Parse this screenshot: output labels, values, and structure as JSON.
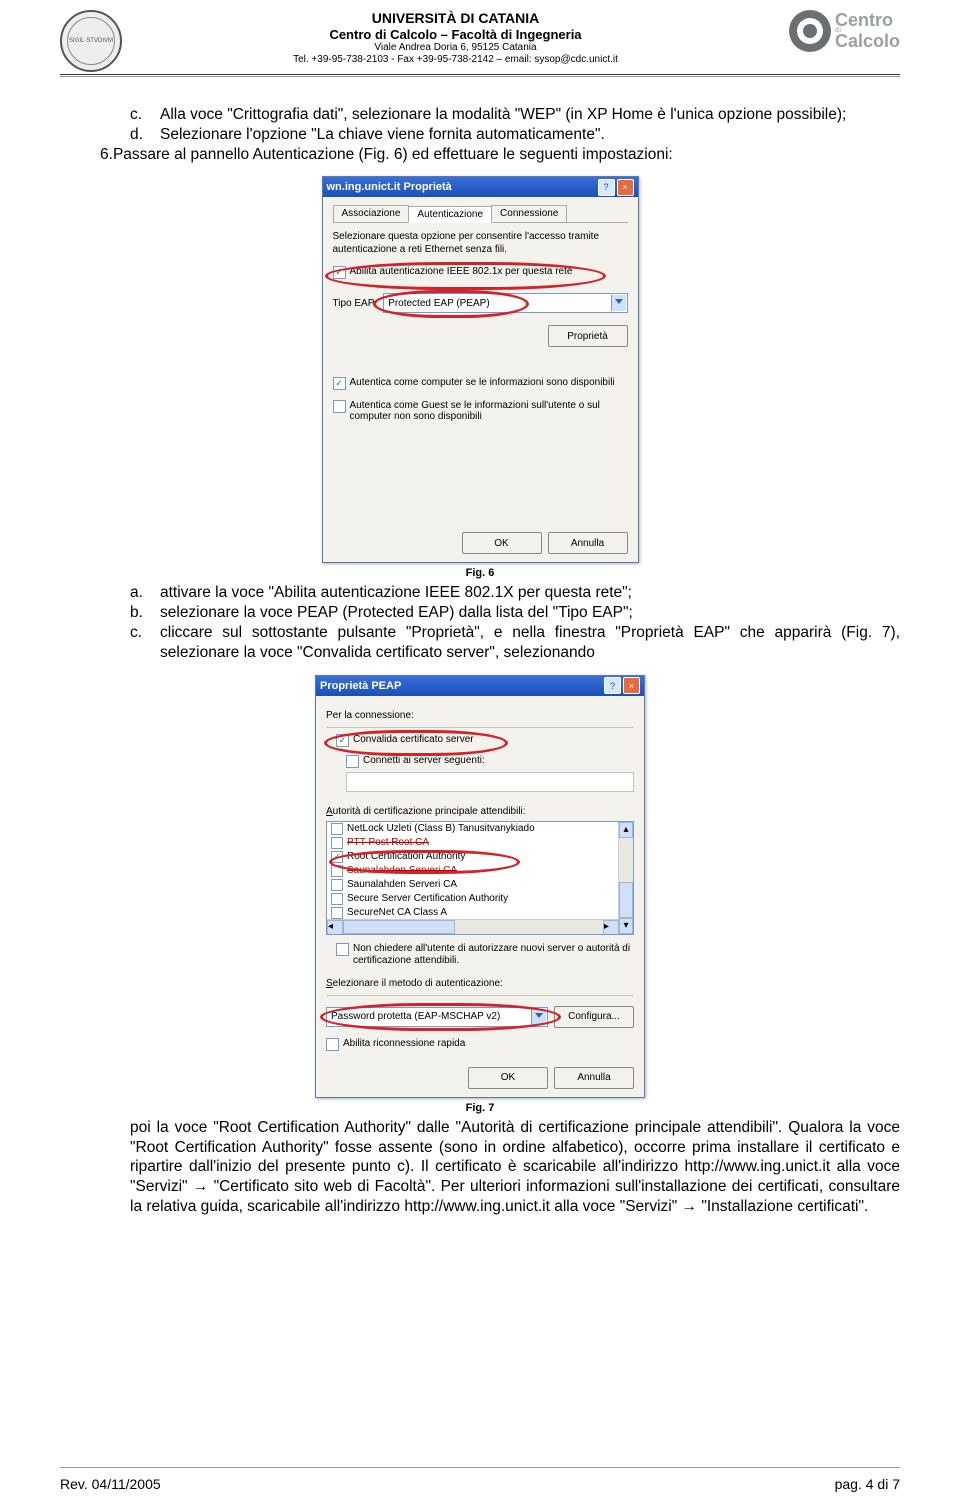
{
  "header": {
    "uni": "UNIVERSITÀ DI CATANIA",
    "centro": "Centro di Calcolo – Facoltà di Ingegneria",
    "addr": "Viale Andrea Doria 6, 95125 Catania",
    "contact": "Tel. +39-95-738-2103  -  Fax +39-95-738-2142 – email: sysop@cdc.unict.it",
    "logo_big": "Centro",
    "logo_sm1": "di",
    "logo_sm2": "Calcolo"
  },
  "body": {
    "c_label": "c.",
    "c_text": "Alla voce \"Crittografia dati\", selezionare la modalità \"WEP\" (in XP Home è l'unica opzione possibile);",
    "d_label": "d.",
    "d_text": "Selezionare l'opzione \"La chiave viene fornita automaticamente\".",
    "p6_label": "6.",
    "p6_text": "Passare al pannello Autenticazione (Fig. 6) ed effettuare le seguenti impostazioni:",
    "fig6_cap": "Fig. 6",
    "a_label": "a.",
    "a_text": "attivare la voce \"Abilita autenticazione IEEE 802.1X per questa rete\";",
    "b_label": "b.",
    "b_text": "selezionare la voce PEAP (Protected EAP) dalla lista del \"Tipo EAP\";",
    "c2_label": "c.",
    "c2_text": "cliccare sul sottostante pulsante \"Proprietà\", e nella finestra \"Proprietà EAP\" che apparirà (Fig. 7), selezionare la voce \"Convalida certificato server\", selezionando",
    "fig7_cap": "Fig. 7",
    "tail": "poi la voce \"Root Certification Authority\" dalle \"Autorità di certificazione principale attendibili\". Qualora la voce \"Root Certification Authority\" fosse assente (sono in ordine alfabetico), occorre prima installare il certificato e ripartire dall'inizio del presente punto c). Il certificato è scaricabile all'indirizzo http://www.ing.unict.it alla voce \"Servizi\" → \"Certificato sito web di Facoltà\". Per ulteriori informazioni sull'installazione dei certificati, consultare la relativa guida, scaricabile all'indirizzo http://www.ing.unict.it alla voce \"Servizi\" → \"Installazione certificati\"."
  },
  "fig6": {
    "title": "wn.ing.unict.it Proprietà",
    "tab1": "Associazione",
    "tab2": "Autenticazione",
    "tab3": "Connessione",
    "lead": "Selezionare questa opzione per consentire l'accesso tramite autenticazione a reti Ethernet senza fili.",
    "chk1": "Abilita autenticazione IEEE 802.1x per questa rete",
    "tipo_lbl": "Tipo EAP:",
    "tipo_val": "Protected EAP (PEAP)",
    "btn_prop": "Proprietà",
    "chk2": "Autentica come computer se le informazioni sono disponibili",
    "chk3": "Autentica come Guest se le informazioni sull'utente o sul computer non sono disponibili",
    "ok": "OK",
    "cancel": "Annulla"
  },
  "fig7": {
    "title": "Proprietà PEAP",
    "group1": "Per la connessione:",
    "chk_conv": "Convalida certificato server",
    "chk_conn": "Connetti ai server seguenti:",
    "auth_lbl": "Autorità di certificazione principale attendibili:",
    "rows": [
      {
        "c": false,
        "t": "NetLock Uzleti (Class B) Tanusitvanykiado"
      },
      {
        "c": false,
        "t": "PTT Post Root CA",
        "strike": true
      },
      {
        "c": true,
        "t": "Root Certification Authority"
      },
      {
        "c": false,
        "t": "Saunalahden Serveri CA",
        "strike": true,
        "partial": true
      },
      {
        "c": false,
        "t": "Saunalahden Serveri CA"
      },
      {
        "c": false,
        "t": "Secure Server Certification Authority"
      },
      {
        "c": false,
        "t": "SecureNet CA Class A"
      }
    ],
    "chk_nochiedere": "Non chiedere all'utente di autorizzare nuovi server o autorità di certificazione attendibili.",
    "sel_met": "Selezionare il metodo di autenticazione:",
    "sel_val": "Password protetta (EAP-MSCHAP v2)",
    "btn_cfg": "Configura...",
    "chk_rapid": "Abilita riconnessione rapida",
    "ok": "OK",
    "cancel": "Annulla"
  },
  "footer": {
    "left": "Rev. 04/11/2005",
    "right": "pag. 4 di 7"
  }
}
